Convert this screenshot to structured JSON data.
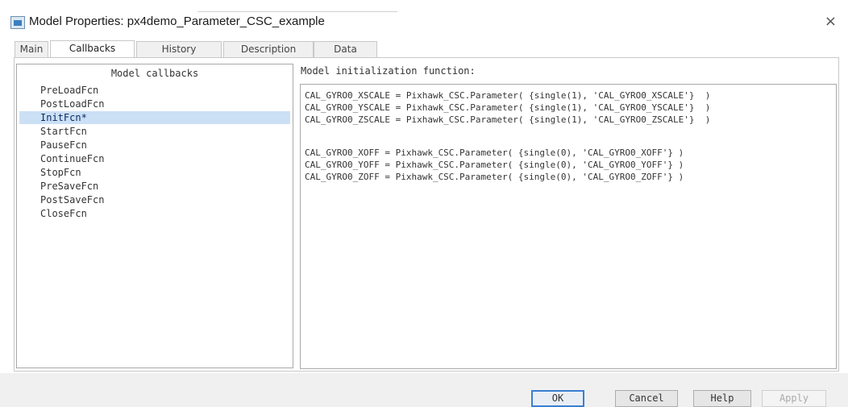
{
  "window": {
    "title": "Model Properties: px4demo_Parameter_CSC_example",
    "close_glyph": "×"
  },
  "tabs": [
    {
      "label": "Main",
      "active": false
    },
    {
      "label": "Callbacks",
      "active": true
    },
    {
      "label": "History",
      "active": false
    },
    {
      "label": "Description",
      "active": false
    },
    {
      "label": "Data",
      "active": false
    }
  ],
  "callbacks_list": {
    "header": "Model callbacks",
    "items": [
      {
        "label": "PreLoadFcn",
        "selected": false
      },
      {
        "label": "PostLoadFcn",
        "selected": false
      },
      {
        "label": "InitFcn*",
        "selected": true
      },
      {
        "label": "StartFcn",
        "selected": false
      },
      {
        "label": "PauseFcn",
        "selected": false
      },
      {
        "label": "ContinueFcn",
        "selected": false
      },
      {
        "label": "StopFcn",
        "selected": false
      },
      {
        "label": "PreSaveFcn",
        "selected": false
      },
      {
        "label": "PostSaveFcn",
        "selected": false
      },
      {
        "label": "CloseFcn",
        "selected": false
      }
    ]
  },
  "editor": {
    "label": "Model initialization function:",
    "lines": [
      "CAL_GYRO0_XSCALE = Pixhawk_CSC.Parameter( {single(1), 'CAL_GYRO0_XSCALE'}  )",
      "CAL_GYRO0_YSCALE = Pixhawk_CSC.Parameter( {single(1), 'CAL_GYRO0_YSCALE'}  )",
      "CAL_GYRO0_ZSCALE = Pixhawk_CSC.Parameter( {single(1), 'CAL_GYRO0_ZSCALE'}  )",
      "",
      "CAL_GYRO0_XOFF = Pixhawk_CSC.Parameter( {single(0), 'CAL_GYRO0_XOFF'} )",
      "CAL_GYRO0_YOFF = Pixhawk_CSC.Parameter( {single(0), 'CAL_GYRO0_YOFF'} )",
      "CAL_GYRO0_ZOFF = Pixhawk_CSC.Parameter( {single(0), 'CAL_GYRO0_ZOFF'} )"
    ]
  },
  "buttons": {
    "ok": "OK",
    "cancel": "Cancel",
    "help": "Help",
    "apply": "Apply"
  },
  "colors": {
    "selection": "#cce0f5",
    "default_button_border": "#3b7fd1"
  }
}
